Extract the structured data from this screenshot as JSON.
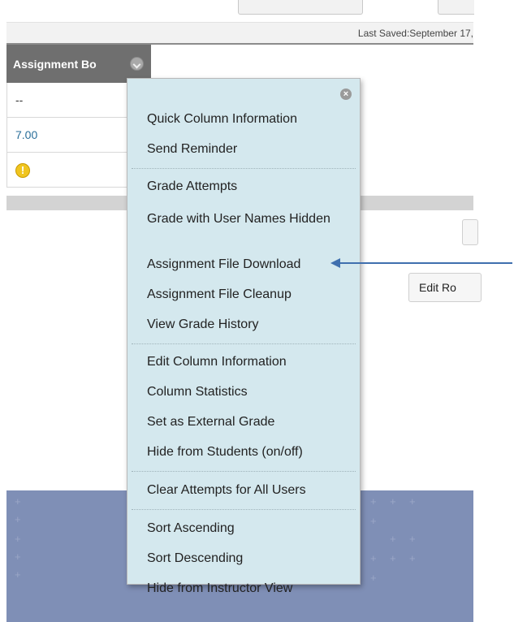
{
  "header": {
    "last_saved": "Last Saved:September 17,"
  },
  "column": {
    "title": "Assignment Bo",
    "cells": [
      "--",
      "7.00"
    ],
    "warning_icon": "exclamation-icon"
  },
  "buttons": {
    "edit_rows": "Edit Ro"
  },
  "menu": {
    "close_icon": "close-icon",
    "items": [
      "Quick Column Information",
      "Send Reminder",
      "Grade Attempts",
      "Grade with User Names Hidden",
      "Assignment File Download",
      "Assignment File Cleanup",
      "View Grade History",
      "Edit Column Information",
      "Column Statistics",
      "Set as External Grade",
      "Hide from Students (on/off)",
      "Clear Attempts for All Users",
      "Sort Ascending",
      "Sort Descending",
      "Hide from Instructor View"
    ]
  },
  "annotation": {
    "arrow_icon": "left-arrow-icon",
    "color": "#3f6fae"
  },
  "colors": {
    "menu_bg": "#d4e8ee",
    "header_bg": "#6f6f6f",
    "footer_bg": "#7f8fb6"
  }
}
